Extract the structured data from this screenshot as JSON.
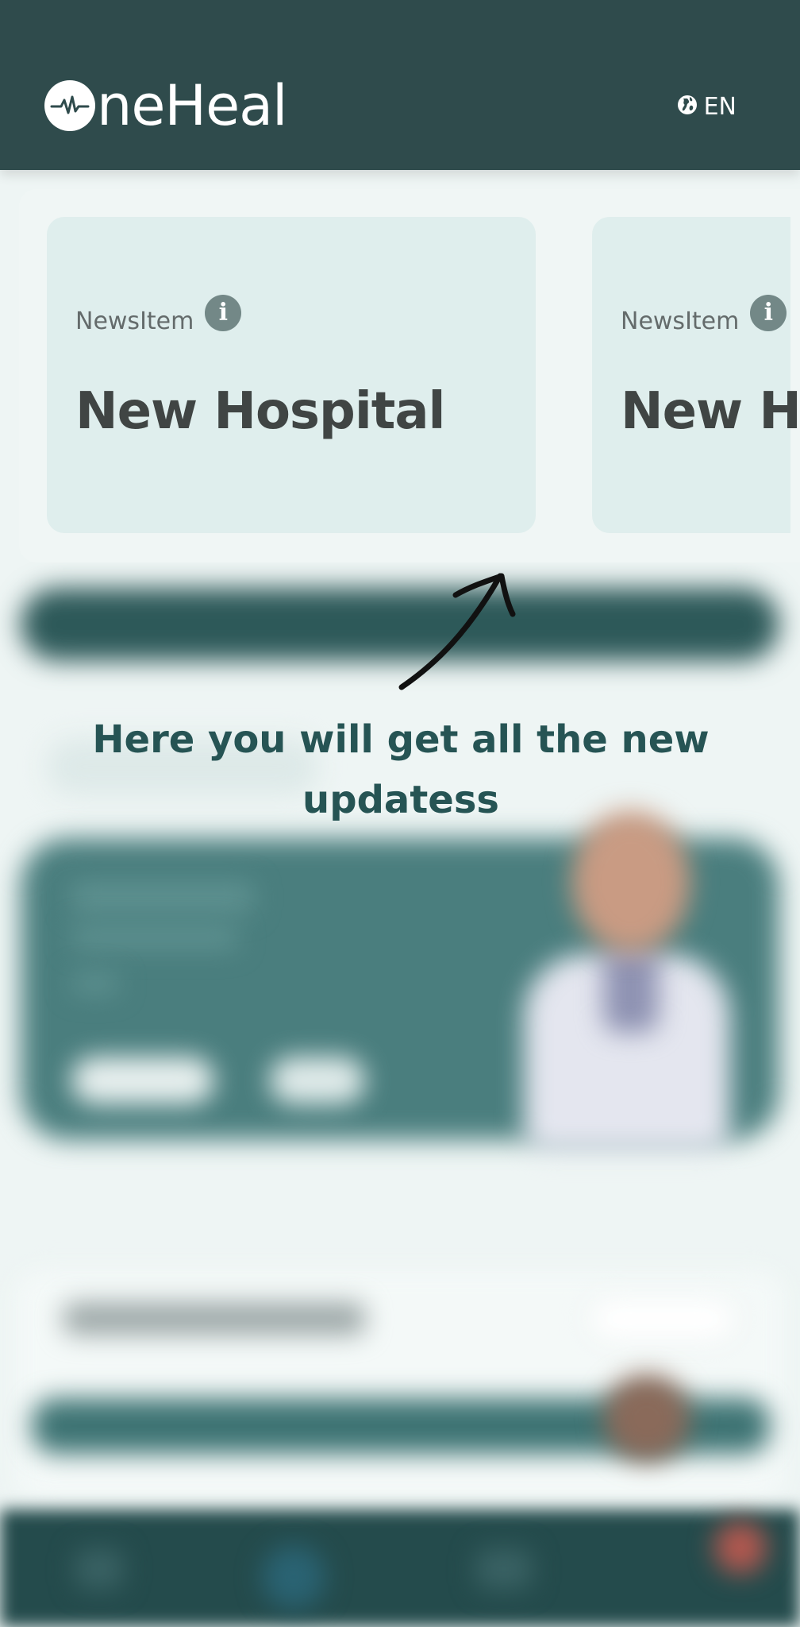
{
  "header": {
    "logo_text": "neHeal",
    "logo_icon": "heartbeat-icon",
    "language_icon": "globe-icon",
    "language": "EN"
  },
  "news": {
    "items": [
      {
        "kicker": "NewsItem",
        "title": "New Hospital"
      },
      {
        "kicker": "NewsItem",
        "title": "New Hospital"
      }
    ]
  },
  "tutorial": {
    "hint": "Here you will get  all the new updatess",
    "pointer_icon": "arrow-up-right-icon"
  },
  "colors": {
    "header_bg": "#2f4b4c",
    "card_bg": "#dfeeed",
    "hint_text": "#265454"
  }
}
